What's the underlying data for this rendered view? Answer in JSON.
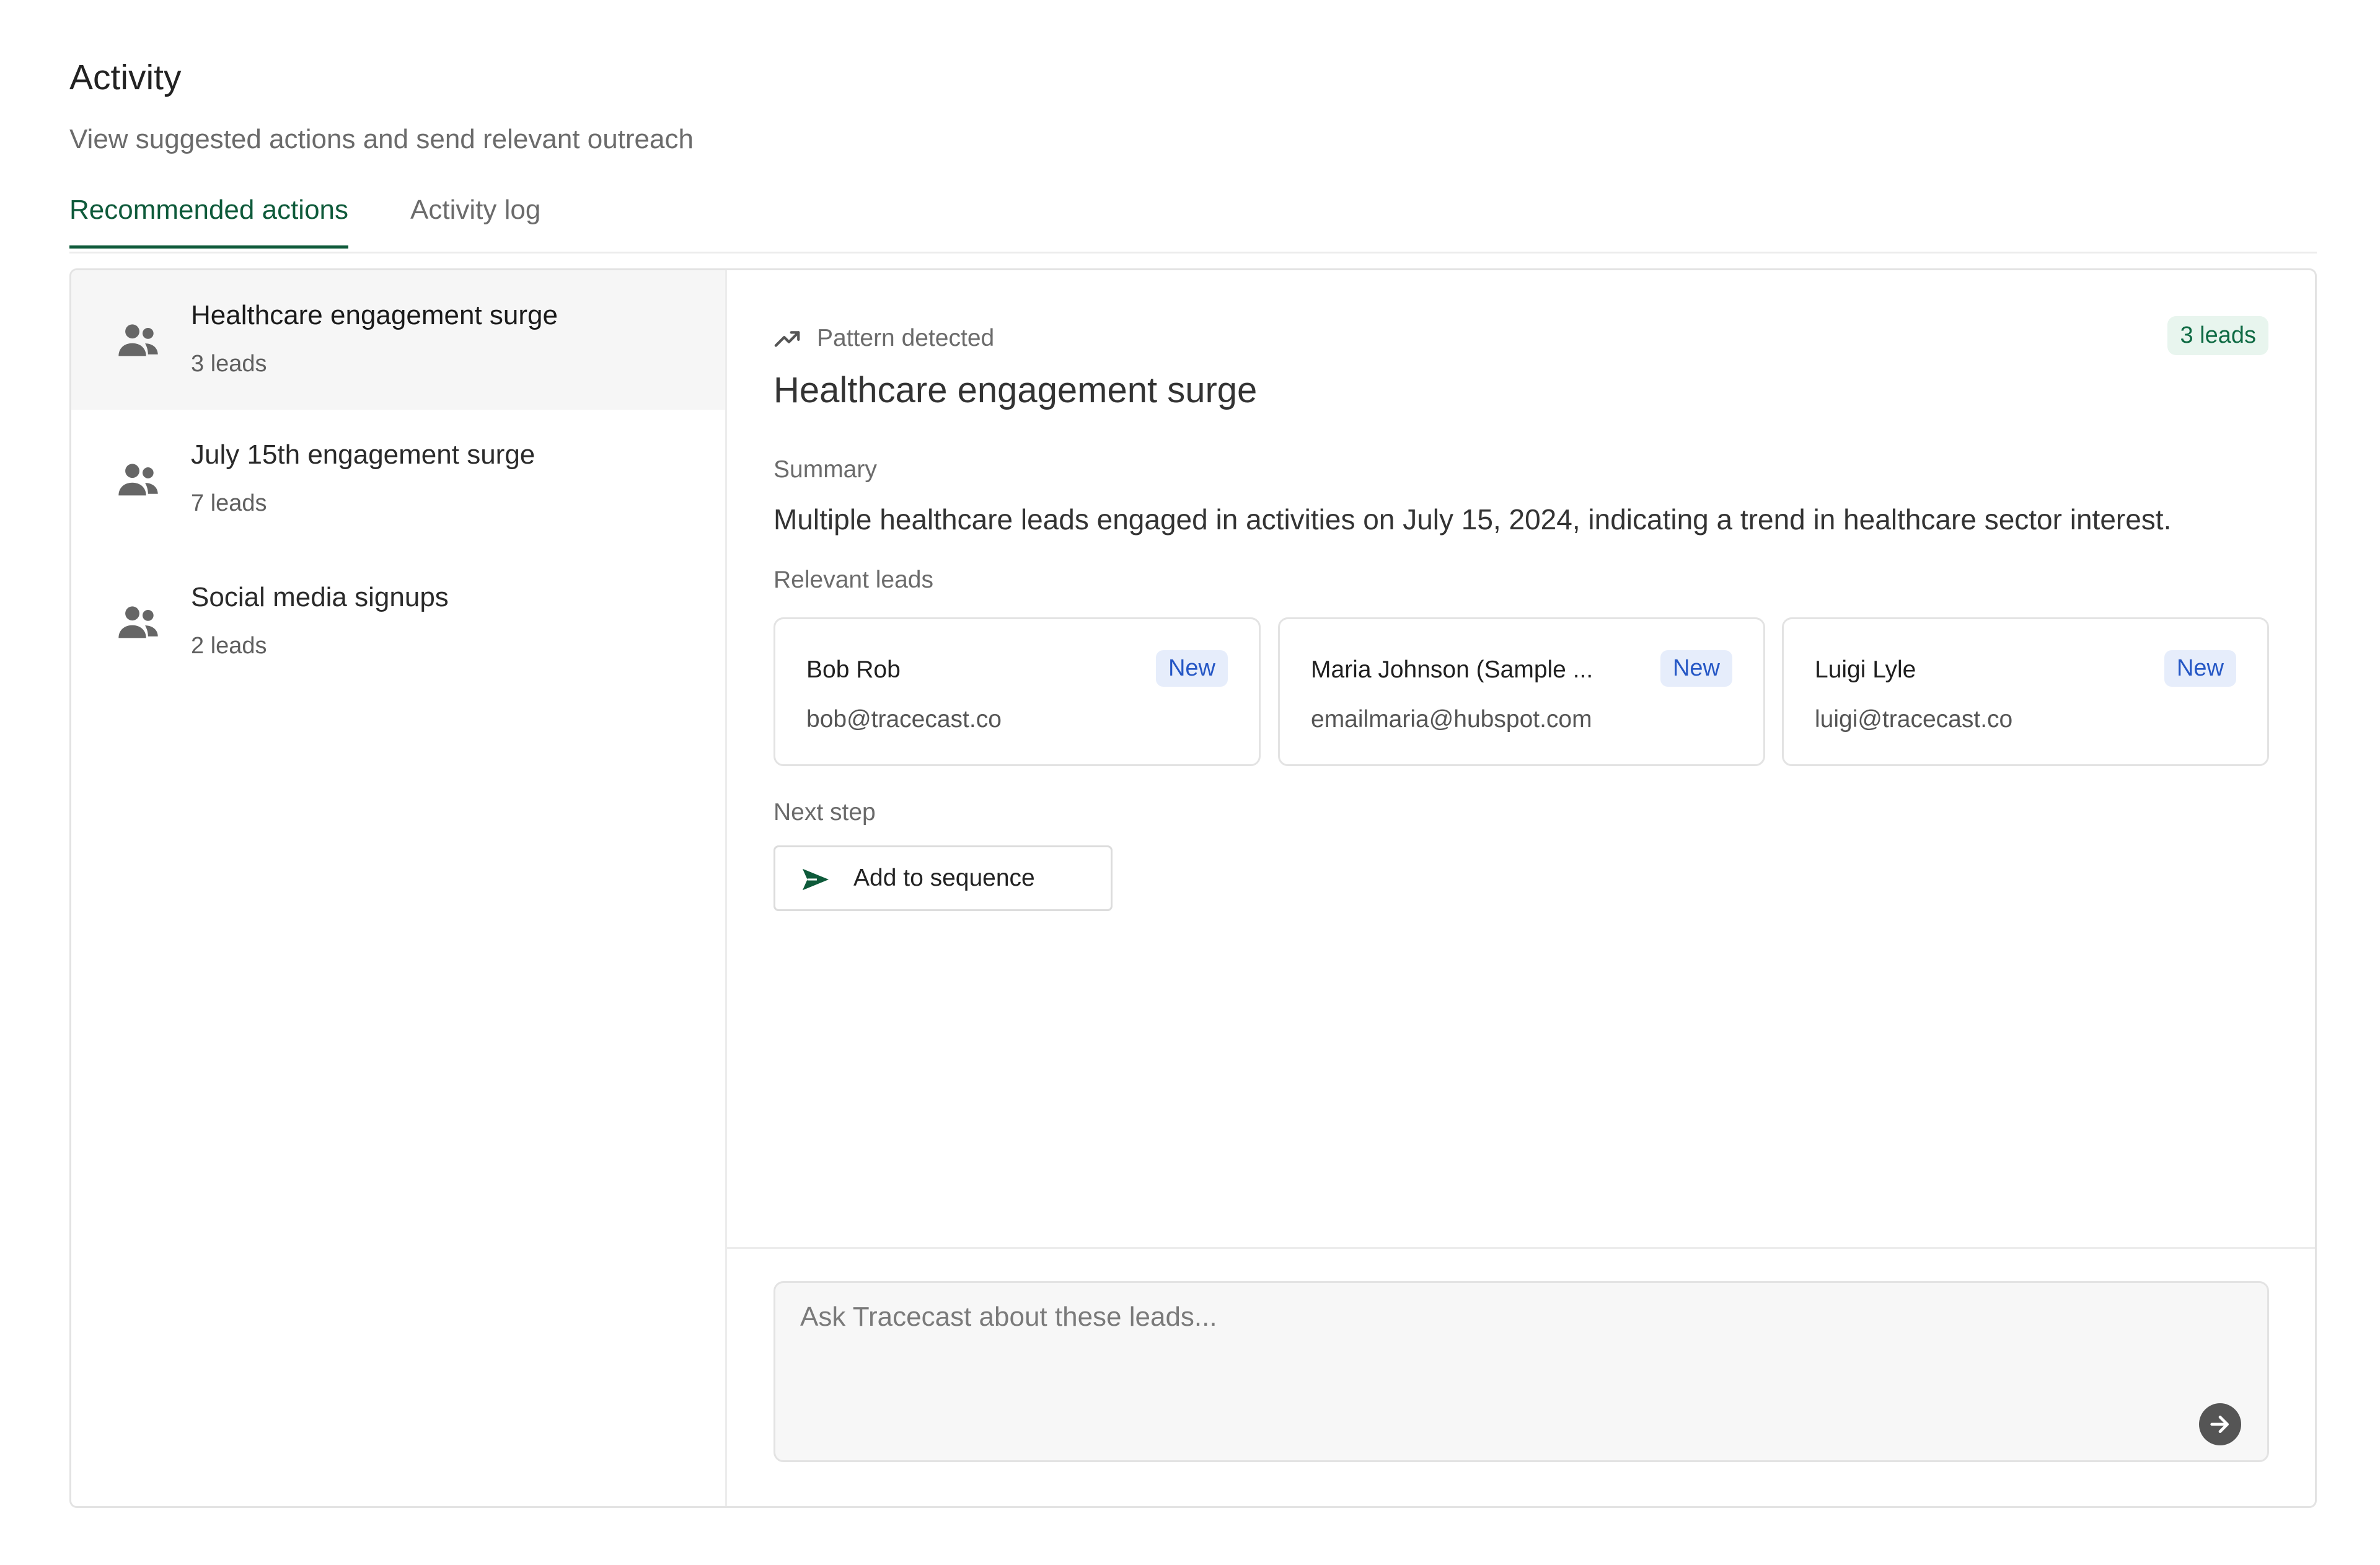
{
  "header": {
    "title": "Activity",
    "subtitle": "View suggested actions and send relevant outreach"
  },
  "tabs": [
    {
      "label": "Recommended actions",
      "active": true
    },
    {
      "label": "Activity log",
      "active": false
    }
  ],
  "groups": [
    {
      "title": "Healthcare engagement surge",
      "count": "3 leads",
      "selected": true,
      "icon": "people-icon"
    },
    {
      "title": "July 15th engagement surge",
      "count": "7 leads",
      "selected": false,
      "icon": "people-icon"
    },
    {
      "title": "Social media signups",
      "count": "2 leads",
      "selected": false,
      "icon": "people-icon"
    }
  ],
  "detail": {
    "pattern_label": "Pattern detected",
    "pattern_icon": "trending-up-icon",
    "leads_badge": "3 leads",
    "title": "Healthcare engagement surge",
    "summary_label": "Summary",
    "summary": "Multiple healthcare leads engaged in activities on July 15, 2024, indicating a trend in healthcare sector interest.",
    "relevant_label": "Relevant leads",
    "leads": [
      {
        "name": "Bob Rob",
        "email": "bob@tracecast.co",
        "status": "New"
      },
      {
        "name": "Maria Johnson (Sample ...",
        "email": "emailmaria@hubspot.com",
        "status": "New"
      },
      {
        "name": "Luigi Lyle",
        "email": "luigi@tracecast.co",
        "status": "New"
      }
    ],
    "next_step_label": "Next step",
    "next_step_button": "Add to sequence",
    "next_step_icon": "send-icon"
  },
  "chat": {
    "placeholder": "Ask Tracecast about these leads...",
    "send_icon": "arrow-right-circle-icon"
  },
  "colors": {
    "accent": "#0e5a3a",
    "badge_green_bg": "#e8f5ee",
    "badge_blue_bg": "#e6edfb",
    "badge_blue_text": "#2557c5"
  }
}
